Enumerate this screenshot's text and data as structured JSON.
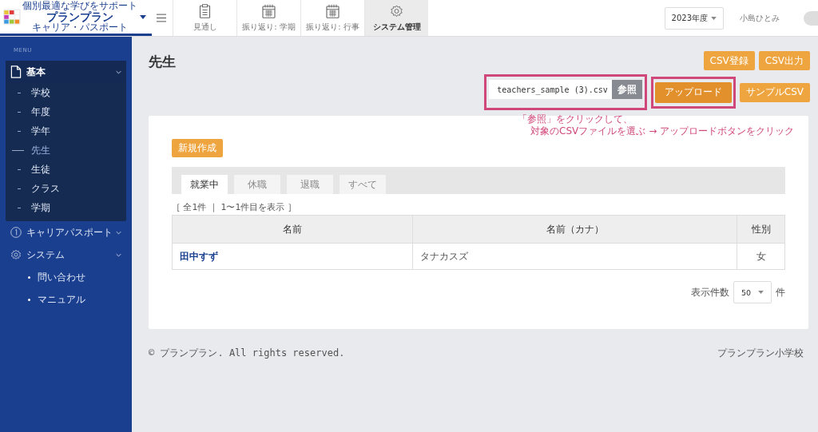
{
  "brand": {
    "tagline": "個別最適な学びをサポート",
    "name": "プランプラン",
    "subtitle": "キャリア・パスポート"
  },
  "nav_tabs": [
    {
      "label": "見通し",
      "selected": false
    },
    {
      "label": "振り返り: 学期",
      "selected": false
    },
    {
      "label": "振り返り: 行事",
      "selected": false
    },
    {
      "label": "システム管理",
      "selected": true
    }
  ],
  "year_select": "2023年度",
  "user_name": "小島ひとみ",
  "sidebar": {
    "heading": "MENU",
    "groups": [
      {
        "label": "基本",
        "highlighted": true,
        "children": [
          {
            "label": "学校",
            "selected": false
          },
          {
            "label": "年度",
            "selected": false
          },
          {
            "label": "学年",
            "selected": false
          },
          {
            "label": "先生",
            "selected": true
          },
          {
            "label": "生徒",
            "selected": false
          },
          {
            "label": "クラス",
            "selected": false
          },
          {
            "label": "学期",
            "selected": false
          }
        ]
      },
      {
        "label": "キャリアパスポート",
        "highlighted": false
      },
      {
        "label": "システム",
        "highlighted": false,
        "children": [
          {
            "label": "問い合わせ",
            "selected": false
          },
          {
            "label": "マニュアル",
            "selected": false
          }
        ]
      }
    ]
  },
  "page_title": "先生",
  "top_buttons": [
    "CSV登録",
    "CSV出力"
  ],
  "file_field": {
    "value": "teachers_sample (3).csv",
    "browse": "参照",
    "highlighted": true
  },
  "upload_button": {
    "label": "アップロード",
    "highlighted": true
  },
  "sample_button": "サンプルCSV",
  "note": [
    "「参照」をクリックして、",
    "対象のCSVファイルを選ぶ → アップロードボタンをクリック"
  ],
  "new_button": "新規作成",
  "filter_tabs": [
    {
      "label": "就業中",
      "selected": true
    },
    {
      "label": "休職",
      "selected": false
    },
    {
      "label": "退職",
      "selected": false
    },
    {
      "label": "すべて",
      "selected": false
    }
  ],
  "summary": "［ 全1件 ｜ 1〜1件目を表示 ］",
  "table": {
    "columns": [
      "名前",
      "名前（カナ）",
      "性別"
    ],
    "rows": [
      [
        "田中すず",
        "タナカスズ",
        "女"
      ]
    ]
  },
  "per_page": {
    "label": "表示件数",
    "value": "50",
    "unit": "件"
  },
  "footer": {
    "copyright": "© プランプラン. All rights reserved.",
    "school": "プランプラン小学校"
  }
}
